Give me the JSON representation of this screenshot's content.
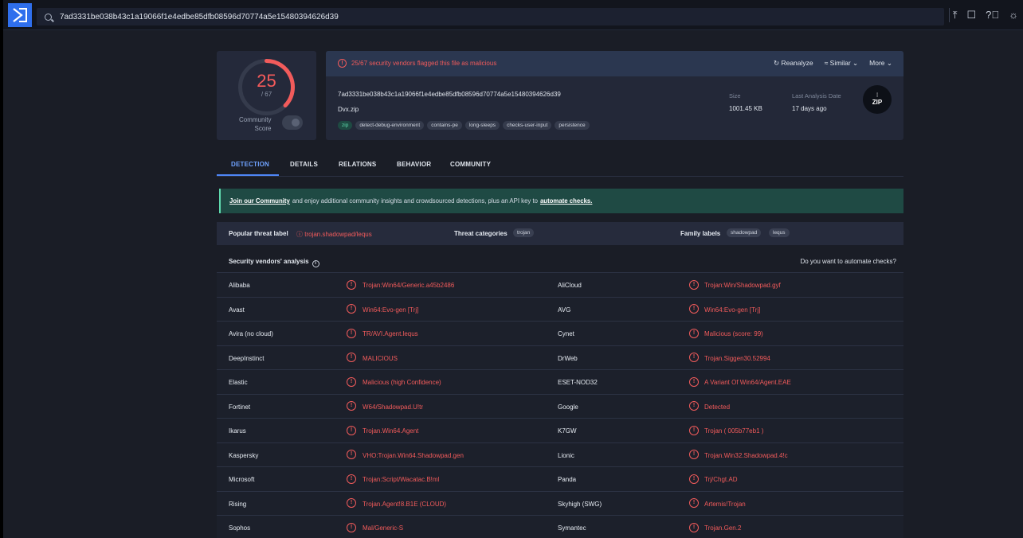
{
  "search": {
    "query": "7ad3331be038b43c1a19066f1e4edbe85dfb08596d70774a5e15480394626d39"
  },
  "score": {
    "detected": "25",
    "total": "/ 67",
    "community_label_1": "Community",
    "community_label_2": "Score",
    "fraction": 0.373
  },
  "alert": {
    "text": "25/67 security vendors flagged this file as malicious"
  },
  "actions": {
    "reanalyze": "Reanalyze",
    "similar": "Similar",
    "more": "More"
  },
  "file": {
    "hash": "7ad3331be038b43c1a19066f1e4edbe85dfb08596d70774a5e15480394626d39",
    "name": "Dvx.zip",
    "tags": [
      "zip",
      "detect-debug-environment",
      "contains-pe",
      "long-sleeps",
      "checks-user-input",
      "persistence"
    ],
    "size_label": "Size",
    "size_value": "1001.45 KB",
    "date_label": "Last Analysis Date",
    "date_value": "17 days ago",
    "type_icon": "ZIP"
  },
  "tabs": [
    "DETECTION",
    "DETAILS",
    "RELATIONS",
    "BEHAVIOR",
    "COMMUNITY"
  ],
  "banner": {
    "link1": "Join our Community",
    "middle": "and enjoy additional community insights and crowdsourced detections, plus an API key to",
    "link2": "automate checks."
  },
  "threat": {
    "popular_label": "Popular threat label",
    "popular_value": "trojan.shadowpad/lequs",
    "categories_label": "Threat categories",
    "categories": [
      "trojan"
    ],
    "family_label": "Family labels",
    "families": [
      "shadowpad",
      "lequs"
    ]
  },
  "vendors": {
    "title": "Security vendors' analysis",
    "automate": "Do you want to automate checks?",
    "rows": [
      {
        "v1": "Alibaba",
        "r1": "Trojan:Win64/Generic.a45b2486",
        "v2": "AliCloud",
        "r2": "Trojan:Win/Shadowpad.gyf"
      },
      {
        "v1": "Avast",
        "r1": "Win64:Evo-gen [Trj]",
        "v2": "AVG",
        "r2": "Win64:Evo-gen [Trj]"
      },
      {
        "v1": "Avira (no cloud)",
        "r1": "TR/AVI.Agent.lequs",
        "v2": "Cynet",
        "r2": "Malicious (score: 99)"
      },
      {
        "v1": "DeepInstinct",
        "r1": "MALICIOUS",
        "v2": "DrWeb",
        "r2": "Trojan.Siggen30.52994"
      },
      {
        "v1": "Elastic",
        "r1": "Malicious (high Confidence)",
        "v2": "ESET-NOD32",
        "r2": "A Variant Of Win64/Agent.EAE"
      },
      {
        "v1": "Fortinet",
        "r1": "W64/Shadowpad.U!tr",
        "v2": "Google",
        "r2": "Detected"
      },
      {
        "v1": "Ikarus",
        "r1": "Trojan.Win64.Agent",
        "v2": "K7GW",
        "r2": "Trojan ( 005b77eb1 )"
      },
      {
        "v1": "Kaspersky",
        "r1": "VHO:Trojan.Win64.Shadowpad.gen",
        "v2": "Lionic",
        "r2": "Trojan.Win32.Shadowpad.4!c"
      },
      {
        "v1": "Microsoft",
        "r1": "Trojan:Script/Wacatac.B!ml",
        "v2": "Panda",
        "r2": "Trj/Chgt.AD"
      },
      {
        "v1": "Rising",
        "r1": "Trojan.Agent!8.B1E (CLOUD)",
        "v2": "Skyhigh (SWG)",
        "r2": "Artemis!Trojan"
      },
      {
        "v1": "Sophos",
        "r1": "Mal/Generic-S",
        "v2": "Symantec",
        "r2": "Trojan.Gen.2"
      }
    ]
  },
  "colors": {
    "danger": "#f25b5b",
    "accent": "#4f86f7",
    "background": "#1a1d26"
  }
}
